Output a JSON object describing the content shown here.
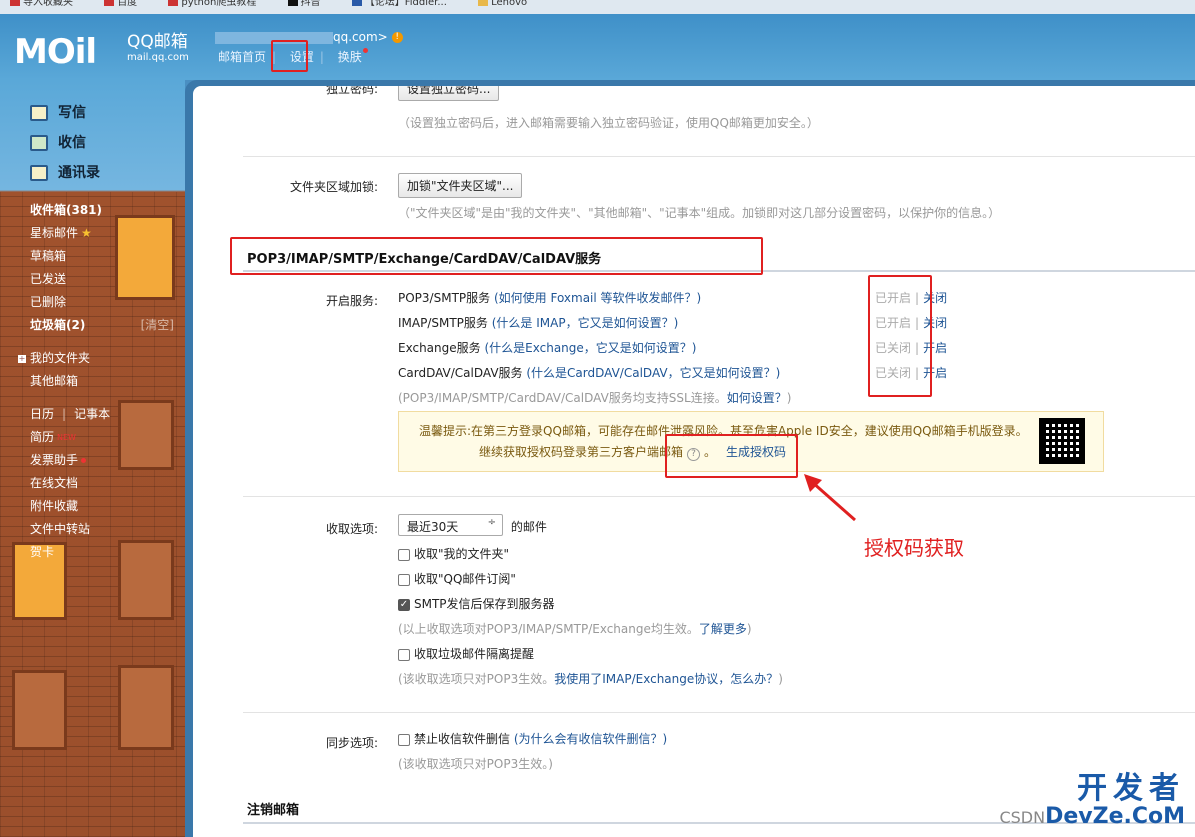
{
  "bookmarks": [
    "导入收藏夹",
    "百度",
    "python爬虫教程",
    "抖音",
    "【论坛】Fiddler...",
    "Lenovo"
  ],
  "header": {
    "logo": "MOil",
    "brand": "QQ邮箱",
    "domain": "mail.qq.com",
    "account_suffix": "qq.com>",
    "warn": "!",
    "nav": [
      "邮箱首页",
      "设置",
      "换肤"
    ]
  },
  "sidebar": {
    "compose": [
      "写信",
      "收信",
      "通讯录"
    ],
    "inbox": "收件箱(381)",
    "starred": "星标邮件",
    "drafts": "草稿箱",
    "sent": "已发送",
    "deleted": "已删除",
    "spam": "垃圾箱(2)",
    "spam_clear": "[清空]",
    "my_folders": "我的文件夹",
    "other_mail": "其他邮箱",
    "calendar": "日历",
    "notes": "记事本",
    "resume": "简历",
    "new_badge": "NEW",
    "invoice": "发票助手",
    "docs": "在线文档",
    "attachments": "附件收藏",
    "transfer": "文件中转站",
    "cards": "贺卡"
  },
  "main": {
    "pwd_label": "独立密码:",
    "pwd_btn": "设置独立密码...",
    "pwd_hint": "（设置独立密码后，进入邮箱需要输入独立密码验证，使用QQ邮箱更加安全。）",
    "lock_label": "文件夹区域加锁:",
    "lock_btn": "加锁\"文件夹区域\"...",
    "lock_hint": "（\"文件夹区域\"是由\"我的文件夹\"、\"其他邮箱\"、\"记事本\"组成。加锁即对这几部分设置密码，以保护你的信息。）",
    "service_title": "POP3/IMAP/SMTP/Exchange/CardDAV/CalDAV服务",
    "enable_label": "开启服务:",
    "services": [
      {
        "name": "POP3/SMTP服务",
        "help": "(如何使用 Foxmail 等软件收发邮件？)",
        "state": "已开启",
        "action": "关闭"
      },
      {
        "name": "IMAP/SMTP服务",
        "help": "(什么是 IMAP，它又是如何设置？)",
        "state": "已开启",
        "action": "关闭"
      },
      {
        "name": "Exchange服务",
        "help": "(什么是Exchange，它又是如何设置？)",
        "state": "已关闭",
        "action": "开启"
      },
      {
        "name": "CardDAV/CalDAV服务",
        "help": "(什么是CardDAV/CalDAV，它又是如何设置？)",
        "state": "已关闭",
        "action": "开启"
      }
    ],
    "ssl_hint": "(POP3/IMAP/SMTP/CardDAV/CalDAV服务均支持SSL连接。",
    "ssl_link": "如何设置？",
    "ssl_end": ")",
    "tip_prefix": "温馨提示:",
    "tip_line1": "在第三方登录QQ邮箱，可能存在邮件泄露风险。甚至危害Apple ID安全，建议使用QQ邮箱手机版登录。",
    "tip_line2": "继续获取授权码登录第三方客户端邮箱",
    "tip_q": "?",
    "tip_dot": "。",
    "gen_code": "生成授权码",
    "receive_label": "收取选项:",
    "receive_select": "最近30天",
    "select_arrow": "÷",
    "receive_suffix": "的邮件",
    "cb1": "收取\"我的文件夹\"",
    "cb2": "收取\"QQ邮件订阅\"",
    "cb3": "SMTP发信后保存到服务器",
    "check_mark": "✓",
    "receive_hint": "(以上收取选项对POP3/IMAP/SMTP/Exchange均生效。",
    "receive_link": "了解更多",
    "receive_hint_end": ")",
    "cb4": "收取垃圾邮件隔离提醒",
    "pop3_hint": "(该收取选项只对POP3生效。",
    "pop3_link": "我使用了IMAP/Exchange协议，怎么办？",
    "pop3_end": ")",
    "sync_label": "同步选项:",
    "cb5": "禁止收信软件删信",
    "cb5_help": "(为什么会有收信软件删信？)",
    "sync_hint": "(该收取选项只对POP3生效。)",
    "cancel_title": "注销邮箱"
  },
  "annotation": "授权码获取",
  "watermark": {
    "top": "开发者",
    "csdn": "CSDN",
    "brand": "DevZe.CoM"
  },
  "colors": {
    "accent_red": "#e02020",
    "link": "#1e5494",
    "header_blue": "#4a8fc2"
  }
}
